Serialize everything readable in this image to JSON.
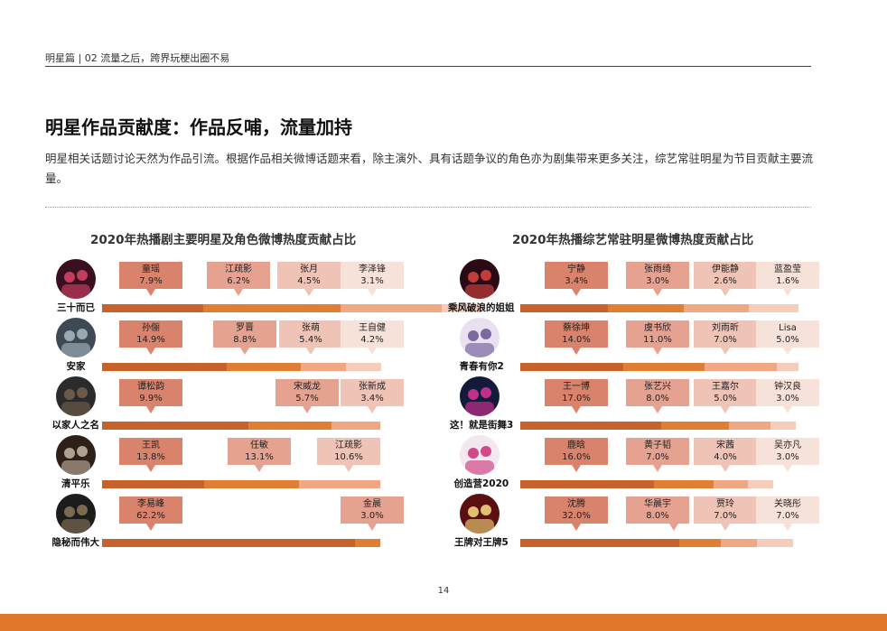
{
  "breadcrumb": "明星篇 | 02  流量之后，跨界玩梗出圈不易",
  "page_title": "明星作品贡献度：作品反哺，流量加持",
  "intro": "明星相关话题讨论天然为作品引流。根据作品相关微博话题来看，除主演外、具有话题争议的角色亦为剧集带来更多关注，综艺常驻明星为节目贡献主要流量。",
  "page_number": "14",
  "colors": {
    "shade1": "#d9826c",
    "shade2": "#e6a291",
    "shade3": "#efc3b6",
    "shade4": "#f7e2da",
    "bar1": "#c8622b",
    "bar2": "#e07f34",
    "bar3": "#f0a884",
    "bar4": "#f6cdbb",
    "footer": "#e0782a"
  },
  "chart_data": [
    {
      "type": "bar",
      "title": "2020年热播剧主要明星及角色微博热度贡献占比",
      "rows": [
        {
          "show": "三十而已",
          "stars": [
            {
              "name": "童瑶",
              "value": "7.9%"
            },
            {
              "name": "江疏影",
              "value": "6.2%"
            },
            {
              "name": "张月",
              "value": "4.5%"
            },
            {
              "name": "李泽锋",
              "value": "3.1%"
            }
          ]
        },
        {
          "show": "安家",
          "stars": [
            {
              "name": "孙俪",
              "value": "14.9%"
            },
            {
              "name": "罗晋",
              "value": "8.8%"
            },
            {
              "name": "张萌",
              "value": "5.4%"
            },
            {
              "name": "王自健",
              "value": "4.2%"
            }
          ]
        },
        {
          "show": "以家人之名",
          "stars": [
            {
              "name": "谭松韵",
              "value": "9.9%"
            },
            {
              "name": "宋威龙",
              "value": "5.7%"
            },
            {
              "name": "张新成",
              "value": "3.4%"
            }
          ]
        },
        {
          "show": "清平乐",
          "stars": [
            {
              "name": "王凯",
              "value": "13.8%"
            },
            {
              "name": "任敏",
              "value": "13.1%"
            },
            {
              "name": "江疏影",
              "value": "10.6%"
            }
          ]
        },
        {
          "show": "隐秘而伟大",
          "stars": [
            {
              "name": "李易峰",
              "value": "62.2%"
            },
            {
              "name": "金晨",
              "value": "3.0%"
            }
          ]
        }
      ]
    },
    {
      "type": "bar",
      "title": "2020年热播综艺常驻明星微博热度贡献占比",
      "rows": [
        {
          "show": "乘风破浪的姐姐",
          "stars": [
            {
              "name": "宁静",
              "value": "3.4%"
            },
            {
              "name": "张雨绮",
              "value": "3.0%"
            },
            {
              "name": "伊能静",
              "value": "2.6%"
            },
            {
              "name": "蓝盈莹",
              "value": "1.6%"
            }
          ]
        },
        {
          "show": "青春有你2",
          "stars": [
            {
              "name": "蔡徐坤",
              "value": "14.0%"
            },
            {
              "name": "虞书欣",
              "value": "11.0%"
            },
            {
              "name": "刘雨昕",
              "value": "7.0%"
            },
            {
              "name": "Lisa",
              "value": "5.0%"
            }
          ]
        },
        {
          "show": "这！就是街舞3",
          "stars": [
            {
              "name": "王一博",
              "value": "17.0%"
            },
            {
              "name": "张艺兴",
              "value": "8.0%"
            },
            {
              "name": "王嘉尔",
              "value": "5.0%"
            },
            {
              "name": "钟汉良",
              "value": "3.0%"
            }
          ]
        },
        {
          "show": "创造营2020",
          "stars": [
            {
              "name": "鹿晗",
              "value": "16.0%"
            },
            {
              "name": "黄子韬",
              "value": "7.0%"
            },
            {
              "name": "宋茜",
              "value": "4.0%"
            },
            {
              "name": "吴亦凡",
              "value": "3.0%"
            }
          ]
        },
        {
          "show": "王牌对王牌5",
          "stars": [
            {
              "name": "沈腾",
              "value": "32.0%"
            },
            {
              "name": "华晨宇",
              "value": "8.0%"
            },
            {
              "name": "贾玲",
              "value": "7.0%"
            },
            {
              "name": "关晓彤",
              "value": "7.0%"
            }
          ]
        }
      ]
    }
  ]
}
